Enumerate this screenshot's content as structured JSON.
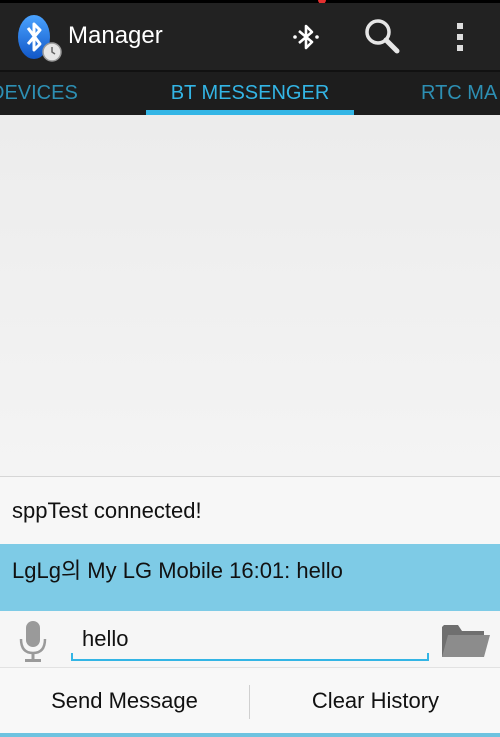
{
  "app": {
    "title": "Manager"
  },
  "actions": {
    "bluetooth_icon": "bluetooth-icon",
    "search_icon": "search-icon",
    "overflow_icon": "overflow-menu-icon"
  },
  "tabs": [
    {
      "label": "DEVICES"
    },
    {
      "label": "BT MESSENGER",
      "selected": true
    },
    {
      "label": "RTC MA"
    }
  ],
  "messages": [
    {
      "text": "sppTest connected!"
    },
    {
      "text": "LgLg의 My LG Mobile 16:01:  hello",
      "highlighted": true
    }
  ],
  "composer": {
    "value": "hello"
  },
  "buttons": {
    "send": "Send Message",
    "clear": "Clear History"
  },
  "colors": {
    "accent": "#33b5e5",
    "highlight": "#7ecbe6",
    "actionbar": "#222222"
  }
}
